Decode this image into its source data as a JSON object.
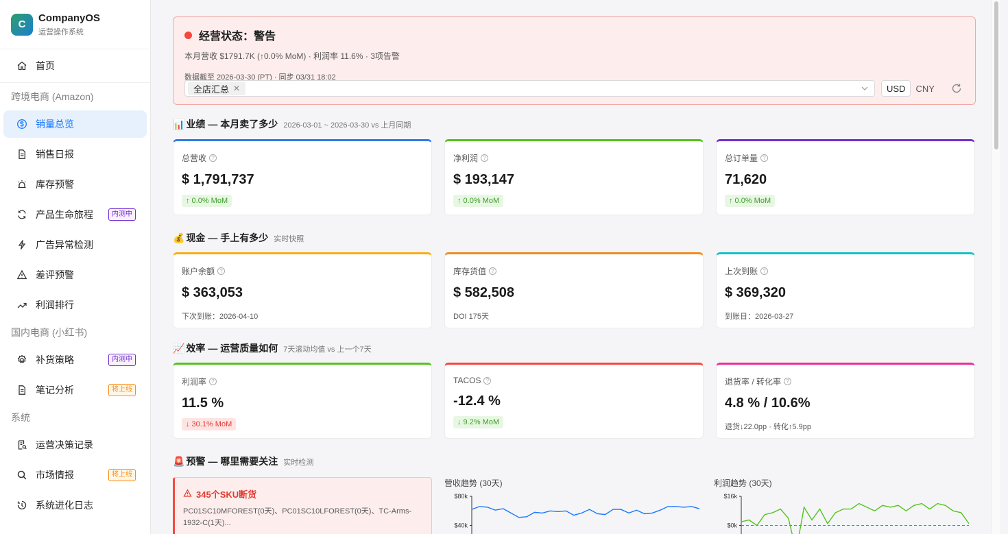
{
  "brand": {
    "logo_letter": "C",
    "title": "CompanyOS",
    "subtitle": "运营操作系统"
  },
  "nav": {
    "home": "首页",
    "group_amazon": "跨境电商 (Amazon)",
    "amazon_items": [
      {
        "label": "销量总览",
        "icon": "dollar-circle-icon",
        "active": true
      },
      {
        "label": "销售日报",
        "icon": "file-icon"
      },
      {
        "label": "库存预警",
        "icon": "alarm-icon"
      },
      {
        "label": "产品生命旅程",
        "icon": "sync-icon",
        "badge": "内测中"
      },
      {
        "label": "广告异常检测",
        "icon": "thunder-icon"
      },
      {
        "label": "差评预警",
        "icon": "warning-icon"
      },
      {
        "label": "利润排行",
        "icon": "trend-icon"
      }
    ],
    "group_xhs": "国内电商 (小红书)",
    "xhs_items": [
      {
        "label": "补货策略",
        "icon": "gear-icon",
        "badge": "内测中"
      },
      {
        "label": "笔记分析",
        "icon": "file-icon",
        "badge": "将上线"
      }
    ],
    "group_system": "系统",
    "system_items": [
      {
        "label": "运营决策记录",
        "icon": "audit-icon"
      },
      {
        "label": "市场情报",
        "icon": "search-icon",
        "badge": "将上线"
      },
      {
        "label": "系统进化日志",
        "icon": "history-icon"
      }
    ]
  },
  "status": {
    "title": "经营状态：警告",
    "summary": "本月营收 $1791.7K (↑0.0% MoM) · 利润率 11.6% · 3项告警",
    "as_of": "数据截至 2026-03-30 (PT) · 同步 03/31 18:02",
    "store_tag": "全店汇总",
    "currency_usd": "USD",
    "currency_cny": "CNY",
    "currency_selected": "USD"
  },
  "sections": {
    "performance": {
      "emoji": "📊",
      "title": "业绩 — 本月卖了多少",
      "sub": "2026-03-01 ~ 2026-03-30 vs 上月同期"
    },
    "cash": {
      "emoji": "💰",
      "title": "现金 — 手上有多少",
      "sub": "实时快照"
    },
    "efficiency": {
      "emoji": "📈",
      "title": "效率 — 运营质量如何",
      "sub": "7天滚动均值 vs 上一个7天"
    },
    "alerts": {
      "emoji": "🚨",
      "title": "预警 — 哪里需要关注",
      "sub": "实时检测"
    }
  },
  "cards": {
    "revenue": {
      "label": "总营收",
      "value": "$ 1,791,737",
      "pill": "↑ 0.0% MoM",
      "color": "#2f7be5"
    },
    "net_profit": {
      "label": "净利润",
      "value": "$ 193,147",
      "pill": "↑ 0.0% MoM",
      "color": "#52c41a"
    },
    "orders": {
      "label": "总订单量",
      "value": "71,620",
      "pill": "↑ 0.0% MoM",
      "color": "#722ed1"
    },
    "balance": {
      "label": "账户余额",
      "value": "$ 363,053",
      "note": "下次到账：2026-04-10",
      "color": "#faad14"
    },
    "inventory": {
      "label": "库存货值",
      "value": "$ 582,508",
      "note": "DOI 175天",
      "color": "#f08c1e"
    },
    "last_payout": {
      "label": "上次到账",
      "value": "$ 369,320",
      "note": "到账日：2026-03-27",
      "color": "#13c2c2"
    },
    "margin": {
      "label": "利润率",
      "value": "11.5 %",
      "pill": "↓ 30.1% MoM",
      "color": "#52c41a"
    },
    "tacos": {
      "label": "TACOS",
      "value": "-12.4 %",
      "pill": "↓ 9.2% MoM",
      "color": "#f5473e"
    },
    "return_conv": {
      "label": "退货率 / 转化率",
      "value": "4.8 % / 10.6%",
      "note": "退货↓22.0pp · 转化↑5.9pp",
      "color": "#eb2f96"
    }
  },
  "alert_card": {
    "title": "345个SKU断货",
    "text": "PC01SC10MFOREST(0天)、PC01SC10LFOREST(0天)、TC-Arms-1932-C(1天)..."
  },
  "chart_data": [
    {
      "type": "line",
      "title": "营收趋势 (30天)",
      "ylim": [
        0,
        80000
      ],
      "yticks": [
        "$80k",
        "$40k"
      ],
      "series": [
        {
          "values": [
            62000,
            66000,
            65000,
            61000,
            63000,
            57000,
            51000,
            52000,
            58000,
            57000,
            60000,
            59000,
            60000,
            54000,
            57000,
            62000,
            56000,
            55000,
            62000,
            62000,
            57000,
            61000,
            56000,
            57000,
            61000,
            66000,
            66000,
            65000,
            66000,
            63000
          ],
          "color": "#1677ff"
        }
      ]
    },
    {
      "type": "line",
      "title": "利润趋势 (30天)",
      "ylim": [
        -16000,
        16000
      ],
      "yticks": [
        "$16k",
        "$0k"
      ],
      "baseline": 0,
      "series": [
        {
          "values": [
            2000,
            3000,
            0,
            6000,
            7000,
            9000,
            4000,
            -14000,
            10000,
            3000,
            9000,
            1000,
            7000,
            9000,
            9000,
            12000,
            10000,
            8000,
            11000,
            10000,
            11000,
            8000,
            11000,
            12000,
            9000,
            12000,
            11000,
            8000,
            7000,
            1000
          ],
          "color": "#52c41a"
        }
      ]
    }
  ]
}
